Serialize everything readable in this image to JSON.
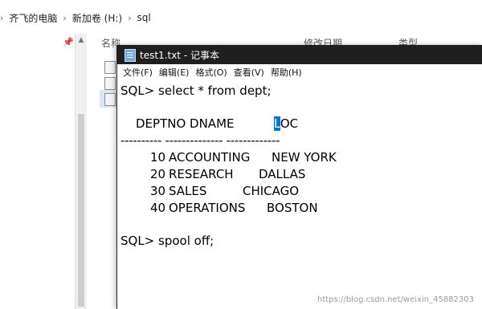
{
  "explorer": {
    "breadcrumb": [
      "齐飞的电脑",
      "新加卷 (H:)",
      "sql"
    ],
    "columns": {
      "name": "名称",
      "date": "修改日期",
      "type": "类型"
    }
  },
  "notepad": {
    "title": "test1.txt - 记事本",
    "menu": [
      "文件(F)",
      "编辑(E)",
      "格式(O)",
      "查看(V)",
      "帮助(H)"
    ],
    "content": {
      "line1": "SQL> select * from dept;",
      "header_a": "DEPTNO DNAME",
      "header_cursor": "L",
      "header_b": "OC",
      "divider": "---------- -------------- -------------",
      "rows": [
        {
          "deptno": "10",
          "dname": "ACCOUNTING",
          "loc": "NEW YORK"
        },
        {
          "deptno": "20",
          "dname": "RESEARCH",
          "loc": "DALLAS"
        },
        {
          "deptno": "30",
          "dname": "SALES",
          "loc": "CHICAGO"
        },
        {
          "deptno": "40",
          "dname": "OPERATIONS",
          "loc": "BOSTON"
        }
      ],
      "spool": "SQL> spool off;"
    }
  },
  "watermark": "https://blog.csdn.net/weixin_45882303"
}
